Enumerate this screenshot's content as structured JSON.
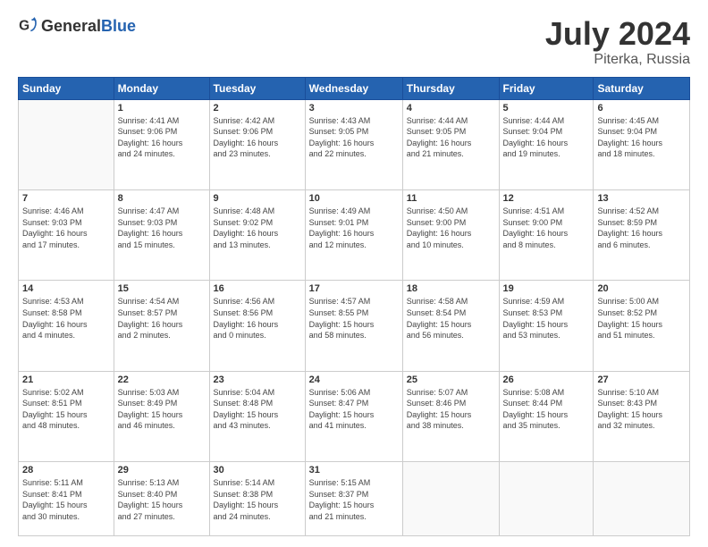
{
  "header": {
    "logo_general": "General",
    "logo_blue": "Blue",
    "month": "July 2024",
    "location": "Piterka, Russia"
  },
  "weekdays": [
    "Sunday",
    "Monday",
    "Tuesday",
    "Wednesday",
    "Thursday",
    "Friday",
    "Saturday"
  ],
  "weeks": [
    [
      {
        "day": "",
        "info": ""
      },
      {
        "day": "1",
        "info": "Sunrise: 4:41 AM\nSunset: 9:06 PM\nDaylight: 16 hours\nand 24 minutes."
      },
      {
        "day": "2",
        "info": "Sunrise: 4:42 AM\nSunset: 9:06 PM\nDaylight: 16 hours\nand 23 minutes."
      },
      {
        "day": "3",
        "info": "Sunrise: 4:43 AM\nSunset: 9:05 PM\nDaylight: 16 hours\nand 22 minutes."
      },
      {
        "day": "4",
        "info": "Sunrise: 4:44 AM\nSunset: 9:05 PM\nDaylight: 16 hours\nand 21 minutes."
      },
      {
        "day": "5",
        "info": "Sunrise: 4:44 AM\nSunset: 9:04 PM\nDaylight: 16 hours\nand 19 minutes."
      },
      {
        "day": "6",
        "info": "Sunrise: 4:45 AM\nSunset: 9:04 PM\nDaylight: 16 hours\nand 18 minutes."
      }
    ],
    [
      {
        "day": "7",
        "info": "Sunrise: 4:46 AM\nSunset: 9:03 PM\nDaylight: 16 hours\nand 17 minutes."
      },
      {
        "day": "8",
        "info": "Sunrise: 4:47 AM\nSunset: 9:03 PM\nDaylight: 16 hours\nand 15 minutes."
      },
      {
        "day": "9",
        "info": "Sunrise: 4:48 AM\nSunset: 9:02 PM\nDaylight: 16 hours\nand 13 minutes."
      },
      {
        "day": "10",
        "info": "Sunrise: 4:49 AM\nSunset: 9:01 PM\nDaylight: 16 hours\nand 12 minutes."
      },
      {
        "day": "11",
        "info": "Sunrise: 4:50 AM\nSunset: 9:00 PM\nDaylight: 16 hours\nand 10 minutes."
      },
      {
        "day": "12",
        "info": "Sunrise: 4:51 AM\nSunset: 9:00 PM\nDaylight: 16 hours\nand 8 minutes."
      },
      {
        "day": "13",
        "info": "Sunrise: 4:52 AM\nSunset: 8:59 PM\nDaylight: 16 hours\nand 6 minutes."
      }
    ],
    [
      {
        "day": "14",
        "info": "Sunrise: 4:53 AM\nSunset: 8:58 PM\nDaylight: 16 hours\nand 4 minutes."
      },
      {
        "day": "15",
        "info": "Sunrise: 4:54 AM\nSunset: 8:57 PM\nDaylight: 16 hours\nand 2 minutes."
      },
      {
        "day": "16",
        "info": "Sunrise: 4:56 AM\nSunset: 8:56 PM\nDaylight: 16 hours\nand 0 minutes."
      },
      {
        "day": "17",
        "info": "Sunrise: 4:57 AM\nSunset: 8:55 PM\nDaylight: 15 hours\nand 58 minutes."
      },
      {
        "day": "18",
        "info": "Sunrise: 4:58 AM\nSunset: 8:54 PM\nDaylight: 15 hours\nand 56 minutes."
      },
      {
        "day": "19",
        "info": "Sunrise: 4:59 AM\nSunset: 8:53 PM\nDaylight: 15 hours\nand 53 minutes."
      },
      {
        "day": "20",
        "info": "Sunrise: 5:00 AM\nSunset: 8:52 PM\nDaylight: 15 hours\nand 51 minutes."
      }
    ],
    [
      {
        "day": "21",
        "info": "Sunrise: 5:02 AM\nSunset: 8:51 PM\nDaylight: 15 hours\nand 48 minutes."
      },
      {
        "day": "22",
        "info": "Sunrise: 5:03 AM\nSunset: 8:49 PM\nDaylight: 15 hours\nand 46 minutes."
      },
      {
        "day": "23",
        "info": "Sunrise: 5:04 AM\nSunset: 8:48 PM\nDaylight: 15 hours\nand 43 minutes."
      },
      {
        "day": "24",
        "info": "Sunrise: 5:06 AM\nSunset: 8:47 PM\nDaylight: 15 hours\nand 41 minutes."
      },
      {
        "day": "25",
        "info": "Sunrise: 5:07 AM\nSunset: 8:46 PM\nDaylight: 15 hours\nand 38 minutes."
      },
      {
        "day": "26",
        "info": "Sunrise: 5:08 AM\nSunset: 8:44 PM\nDaylight: 15 hours\nand 35 minutes."
      },
      {
        "day": "27",
        "info": "Sunrise: 5:10 AM\nSunset: 8:43 PM\nDaylight: 15 hours\nand 32 minutes."
      }
    ],
    [
      {
        "day": "28",
        "info": "Sunrise: 5:11 AM\nSunset: 8:41 PM\nDaylight: 15 hours\nand 30 minutes."
      },
      {
        "day": "29",
        "info": "Sunrise: 5:13 AM\nSunset: 8:40 PM\nDaylight: 15 hours\nand 27 minutes."
      },
      {
        "day": "30",
        "info": "Sunrise: 5:14 AM\nSunset: 8:38 PM\nDaylight: 15 hours\nand 24 minutes."
      },
      {
        "day": "31",
        "info": "Sunrise: 5:15 AM\nSunset: 8:37 PM\nDaylight: 15 hours\nand 21 minutes."
      },
      {
        "day": "",
        "info": ""
      },
      {
        "day": "",
        "info": ""
      },
      {
        "day": "",
        "info": ""
      }
    ]
  ]
}
